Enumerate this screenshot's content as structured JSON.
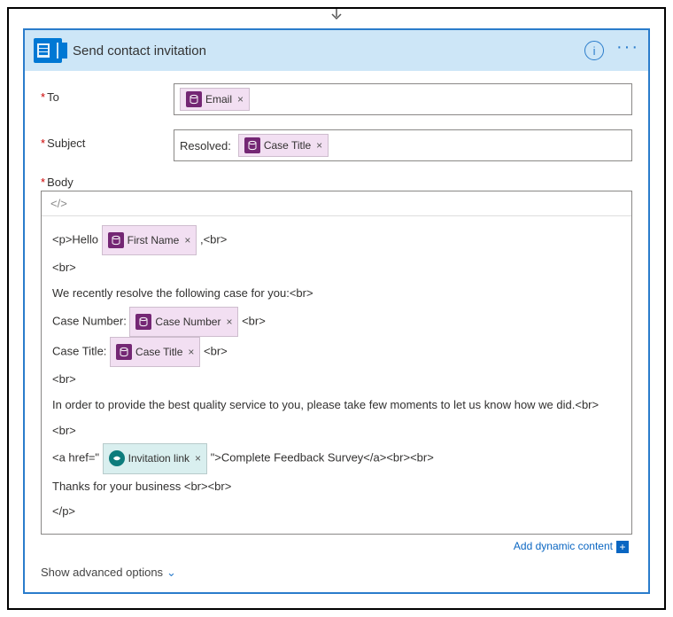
{
  "header": {
    "title": "Send contact invitation"
  },
  "fields": {
    "to_label": "To",
    "subject_label": "Subject",
    "subject_prefix": "Resolved:",
    "body_label": "Body"
  },
  "tokens": {
    "email": "Email",
    "case_title": "Case Title",
    "first_name": "First Name",
    "case_number": "Case Number",
    "invitation_link": "Invitation link"
  },
  "body": {
    "code_toggle": "</>",
    "line1_a": "<p>Hello ",
    "line1_b": ",<br>",
    "line2": "<br>",
    "line3": "We recently resolve the following case for you:<br>",
    "line4_a": "Case Number: ",
    "line4_b": " <br>",
    "line5_a": "Case Title: ",
    "line5_b": " <br>",
    "line6": "<br>",
    "line7": "In order to provide the best quality service to you, please take few moments to let us know how we did.<br>",
    "line8": "<br>",
    "line9_a": "<a href=\"",
    "line9_b": "\">Complete Feedback Survey</a><br><br>",
    "line10": "Thanks for your business <br><br>",
    "line11": "</p>"
  },
  "footer": {
    "dynamic": "Add dynamic content",
    "advanced": "Show advanced options"
  },
  "glyphs": {
    "info": "i",
    "ellipsis": "···",
    "close": "×",
    "chevron": "⌄",
    "plus": "+",
    "arrow": "⇩",
    "db": "◫"
  }
}
